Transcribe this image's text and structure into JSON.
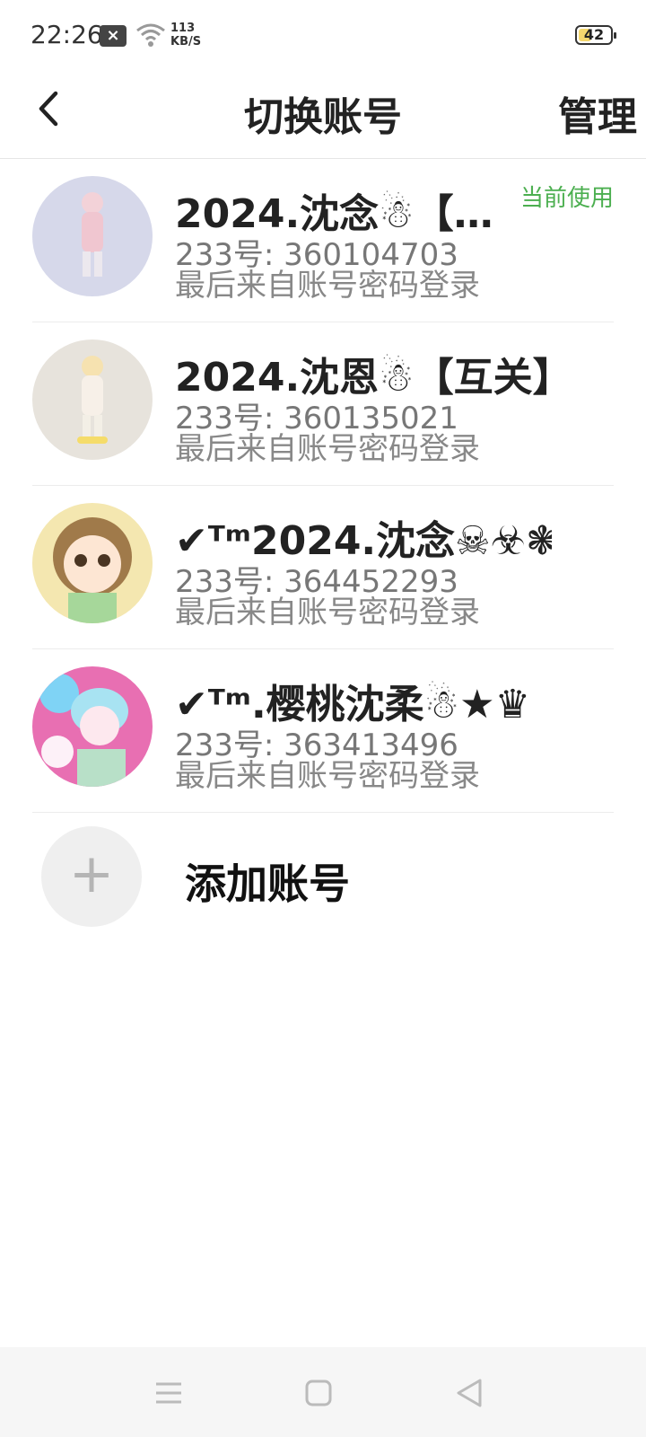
{
  "status": {
    "time": "22:26",
    "notification_icon": "x-badge-icon",
    "net_speed": "113",
    "net_unit": "KB/S",
    "battery": "42",
    "battery_level": 0.42
  },
  "header": {
    "title": "切换账号",
    "manage_label": "管理",
    "back_icon": "chevron-left-icon"
  },
  "accounts": [
    {
      "name": "2024.沈念☃【…",
      "id_label": "233号: 360104703",
      "login": "最后来自账号密码登录",
      "badge": "当前使用",
      "avatar_bg": "#d6d8ea"
    },
    {
      "name": "2024.沈恩☃【互关】",
      "id_label": "233号: 360135021",
      "login": "最后来自账号密码登录",
      "avatar_bg": "#e7e3dc"
    },
    {
      "name": "✔ᵀᵐ2024.沈念☠☣❃",
      "id_label": "233号: 364452293",
      "login": "最后来自账号密码登录",
      "avatar_bg": "#f4e7b0"
    },
    {
      "name": "✔ᵀᵐ.樱桃沈柔☃★♛",
      "id_label": "233号: 363413496",
      "login": "最后来自账号密码登录",
      "avatar_bg": "#e86fb2"
    }
  ],
  "add_account": {
    "label": "添加账号",
    "icon": "+"
  },
  "nav": {
    "menu_icon": "menu-icon",
    "home_icon": "home-square-icon",
    "back_icon": "back-triangle-icon"
  },
  "colors": {
    "badge": "#4caf50",
    "text_secondary": "#777777"
  }
}
